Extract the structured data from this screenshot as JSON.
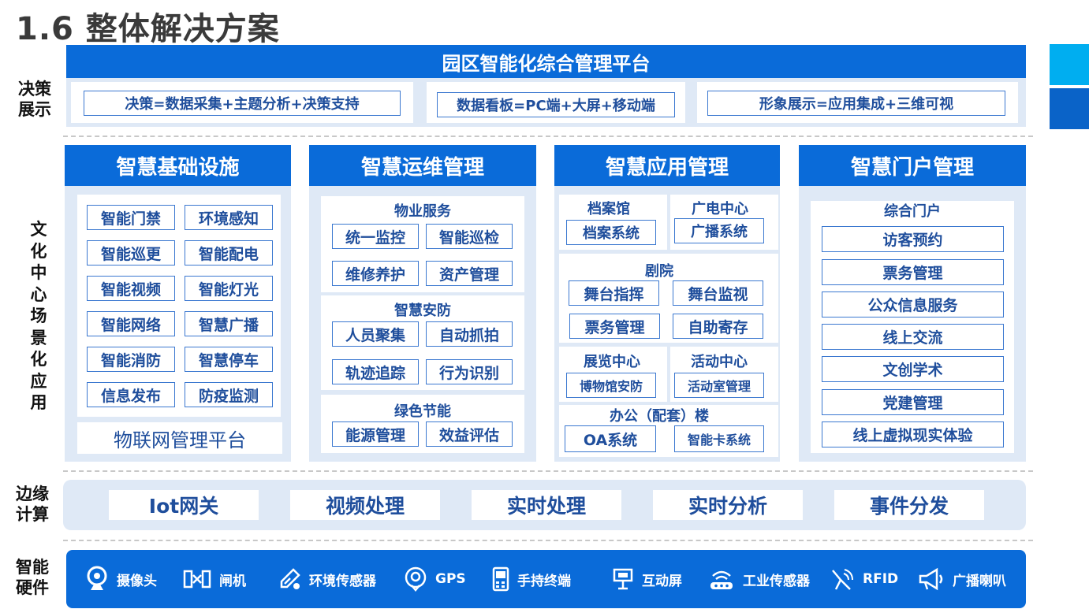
{
  "title": "1.6 整体解决方案",
  "platform_title": "园区智能化综合管理平台",
  "layers": {
    "decision": [
      "决策",
      "展示"
    ],
    "culture": "文化中心场景化应用",
    "edge": [
      "边缘",
      "计算"
    ],
    "hardware": [
      "智能",
      "硬件"
    ]
  },
  "decision_items": [
    "决策=数据采集+主题分析+决策支持",
    "数据看板=PC端+大屏+移动端",
    "形象展示=应用集成+三维可视"
  ],
  "infra": {
    "title": "智慧基础设施",
    "items": [
      "智能门禁",
      "环境感知",
      "智能巡更",
      "智能配电",
      "智能视频",
      "智能灯光",
      "智能网络",
      "智慧广播",
      "智能消防",
      "智慧停车",
      "信息发布",
      "防疫监测"
    ],
    "platform": "物联网管理平台"
  },
  "ops": {
    "title": "智慧运维管理",
    "groups": [
      {
        "label": "物业服务",
        "items": [
          "统一监控",
          "智能巡检",
          "维修养护",
          "资产管理"
        ]
      },
      {
        "label": "智慧安防",
        "items": [
          "人员聚集",
          "自动抓拍",
          "轨迹追踪",
          "行为识别"
        ]
      },
      {
        "label": "绿色节能",
        "items": [
          "能源管理",
          "效益评估"
        ]
      }
    ]
  },
  "apps": {
    "title": "智慧应用管理",
    "archive": {
      "label": "档案馆",
      "item": "档案系统"
    },
    "broadcast": {
      "label": "广电中心",
      "item": "广播系统"
    },
    "theater": {
      "label": "剧院",
      "items": [
        "舞台指挥",
        "舞台监视",
        "票务管理",
        "自助寄存"
      ]
    },
    "exhibit": {
      "label": "展览中心",
      "item": "博物馆安防"
    },
    "activity": {
      "label": "活动中心",
      "item": "活动室管理"
    },
    "office": {
      "label": "办公（配套）楼",
      "items": [
        "OA系统",
        "智能卡系统"
      ]
    }
  },
  "portal": {
    "title": "智慧门户管理",
    "label": "综合门户",
    "items": [
      "访客预约",
      "票务管理",
      "公众信息服务",
      "线上交流",
      "文创学术",
      "党建管理",
      "线上虚拟现实体验"
    ]
  },
  "edge_items": [
    "Iot网关",
    "视频处理",
    "实时处理",
    "实时分析",
    "事件分发"
  ],
  "hardware": [
    {
      "icon": "camera-icon",
      "label": "摄像头"
    },
    {
      "icon": "gate-icon",
      "label": "闸机"
    },
    {
      "icon": "env-sensor-icon",
      "label": "环境传感器"
    },
    {
      "icon": "gps-icon",
      "label": "GPS"
    },
    {
      "icon": "handheld-icon",
      "label": "手持终端"
    },
    {
      "icon": "interactive-screen-icon",
      "label": "互动屏"
    },
    {
      "icon": "industrial-sensor-icon",
      "label": "工业传感器"
    },
    {
      "icon": "rfid-icon",
      "label": "RFID"
    },
    {
      "icon": "speaker-icon",
      "label": "广播喇叭"
    }
  ],
  "colors": {
    "primary": "#0a6bd9",
    "panel": "#dfe9f6",
    "text": "#1f4e9c",
    "accent_cyan": "#00aef0",
    "accent_blue": "#0a63c8"
  }
}
